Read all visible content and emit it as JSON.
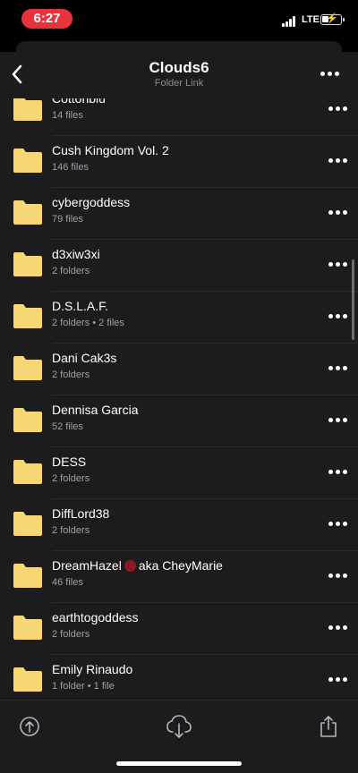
{
  "status": {
    "time": "6:27",
    "network": "LTE"
  },
  "header": {
    "title": "Clouds6",
    "subtitle": "Folder Link"
  },
  "folders": [
    {
      "name": "Cottonblu",
      "meta": "14 files"
    },
    {
      "name": "Cush Kingdom Vol. 2",
      "meta": "146 files"
    },
    {
      "name": "cybergoddess",
      "meta": "79 files"
    },
    {
      "name": "d3xiw3xi",
      "meta": "2 folders"
    },
    {
      "name": "D.S.L.A.F.",
      "meta": "2 folders • 2 files"
    },
    {
      "name": "Dani Cak3s",
      "meta": "2 folders"
    },
    {
      "name": "Dennisa Garcia",
      "meta": "52 files"
    },
    {
      "name": "DESS",
      "meta": "2 folders"
    },
    {
      "name": "DiffLord38",
      "meta": "2 folders"
    },
    {
      "name_part1": "DreamHazel",
      "name_part2": "aka CheyMarie",
      "meta": "46 files"
    },
    {
      "name": "earthtogoddess",
      "meta": "2 folders"
    },
    {
      "name": "Emily Rinaudo",
      "meta": "1 folder • 1 file"
    }
  ],
  "toolbar": [
    "upload-icon",
    "download-icon",
    "share-icon"
  ],
  "colors": {
    "folder": "#f7d774",
    "background": "#1c1c1e",
    "status_pill": "#e8333b"
  }
}
